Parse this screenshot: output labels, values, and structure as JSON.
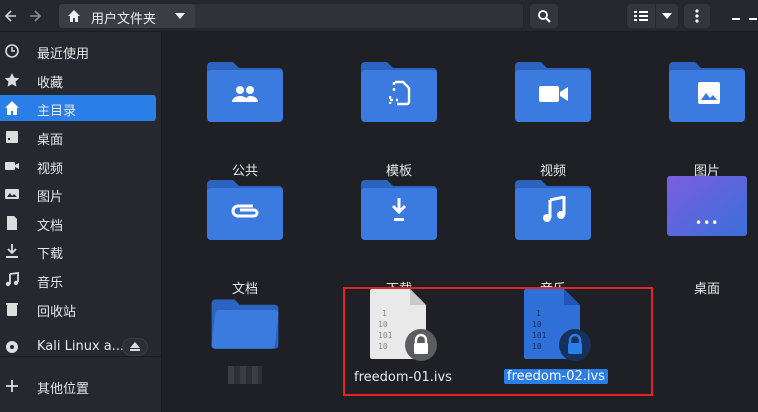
{
  "header": {
    "path_label": "用户文件夹"
  },
  "sidebar": {
    "items": [
      {
        "label": "最近使用",
        "icon": "clock-icon"
      },
      {
        "label": "收藏",
        "icon": "star-icon"
      },
      {
        "label": "主目录",
        "icon": "home-icon",
        "active": true
      },
      {
        "label": "桌面",
        "icon": "desktop-icon"
      },
      {
        "label": "视频",
        "icon": "video-icon"
      },
      {
        "label": "图片",
        "icon": "image-icon"
      },
      {
        "label": "文档",
        "icon": "document-icon"
      },
      {
        "label": "下载",
        "icon": "download-icon"
      },
      {
        "label": "音乐",
        "icon": "music-icon"
      },
      {
        "label": "回收站",
        "icon": "trash-icon"
      },
      {
        "label": "Kali Linux a...",
        "icon": "disc-icon"
      },
      {
        "label": "其他位置",
        "icon": "plus-icon"
      }
    ]
  },
  "main": {
    "folders": [
      {
        "label": "公共",
        "icon": "people-icon"
      },
      {
        "label": "模板",
        "icon": "template-icon"
      },
      {
        "label": "视频",
        "icon": "video-icon"
      },
      {
        "label": "图片",
        "icon": "image-icon"
      },
      {
        "label": "文档",
        "icon": "paperclip-icon"
      },
      {
        "label": "下载",
        "icon": "download-icon"
      },
      {
        "label": "音乐",
        "icon": "music-icon"
      },
      {
        "label": "桌面",
        "icon": "desktop-icon"
      }
    ],
    "files": [
      {
        "label": "freedom-01.ivs",
        "binary_text": "1\n10\n101\n10"
      },
      {
        "label": "freedom-02.ivs",
        "binary_text": "1\n10\n101\n10",
        "selected": true
      }
    ],
    "desktop_tile_dots": "•••"
  },
  "colors": {
    "accent": "#2a7ee8",
    "folder": "#3b7be0",
    "folder_dark": "#2c63bf",
    "highlight": "#e52323"
  }
}
